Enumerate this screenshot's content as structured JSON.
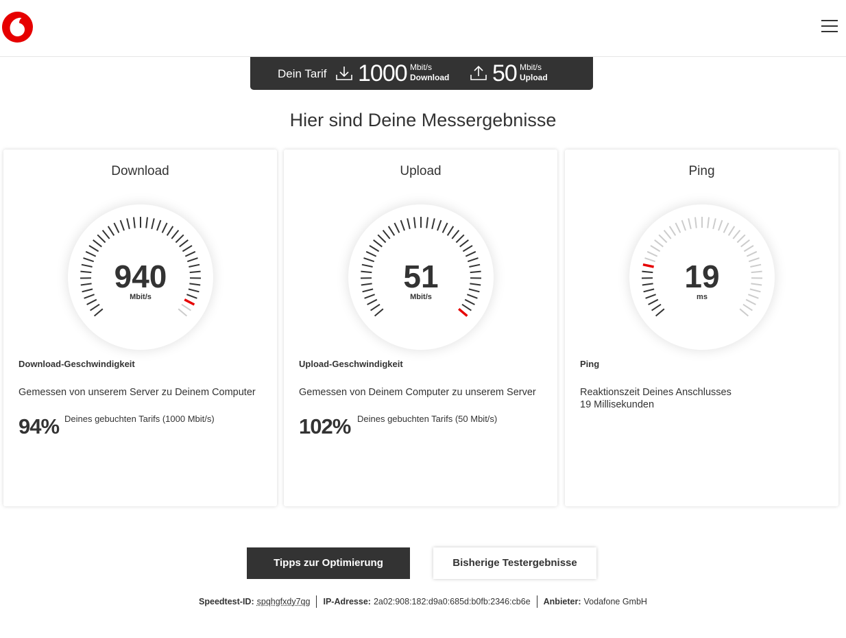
{
  "header": {
    "logo_icon": "vodafone-logo-icon",
    "menu_icon": "hamburger-menu-icon",
    "brand_color": "#e60000"
  },
  "tariff": {
    "label": "Dein Tarif",
    "download": {
      "value": "1000",
      "unit": "Mbit/s",
      "caption": "Download",
      "icon": "download-icon"
    },
    "upload": {
      "value": "50",
      "unit": "Mbit/s",
      "caption": "Upload",
      "icon": "upload-icon"
    }
  },
  "heading": "Hier sind Deine Messergebnisse",
  "cards": [
    {
      "title": "Download",
      "value": "940",
      "unit": "Mbit/s",
      "gauge_fraction": 0.94,
      "subtitle": "Download-Geschwindigkeit",
      "description": "Gemessen von unserem Server zu Deinem Computer",
      "percent": "94%",
      "percent_note": "Deines gebuchten Tarifs (1000 Mbit/s)"
    },
    {
      "title": "Upload",
      "value": "51",
      "unit": "Mbit/s",
      "gauge_fraction": 1.0,
      "subtitle": "Upload-Geschwindigkeit",
      "description": "Gemessen von Deinem Computer zu unserem Server",
      "percent": "102%",
      "percent_note": "Deines gebuchten Tarifs (50 Mbit/s)"
    },
    {
      "title": "Ping",
      "value": "19",
      "unit": "ms",
      "gauge_fraction": 0.19,
      "subtitle": "Ping",
      "description_line1": "Reaktionszeit Deines Anschlusses",
      "description_line2": "19 Millisekunden"
    }
  ],
  "buttons": {
    "tips": "Tipps zur Optimierung",
    "history": "Bisherige Testergebnisse"
  },
  "footer": {
    "id_label": "Speedtest-ID:",
    "id_value": "spqhgfxdy7qg",
    "ip_label": "IP-Adresse:",
    "ip_value": "2a02:908:182:d9a0:685d:b0fb:2346:cb6e",
    "provider_label": "Anbieter:",
    "provider_value": "Vodafone GmbH"
  },
  "colors": {
    "dark": "#333333",
    "accent": "#e60000",
    "tick_light": "#cccccc"
  }
}
